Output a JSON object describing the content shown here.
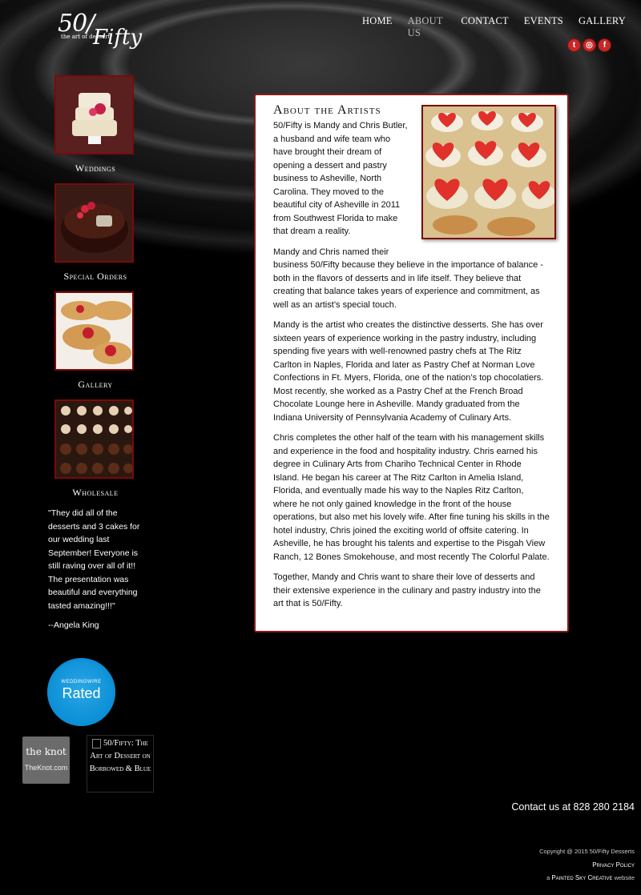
{
  "brand": {
    "logo_text": "50/",
    "logo_fifty": "Fifty",
    "logo_tagline": "the art of dessert"
  },
  "nav": {
    "items": [
      {
        "label": "HOME"
      },
      {
        "label": "ABOUT US"
      },
      {
        "label": "CONTACT"
      },
      {
        "label": "EVENTS"
      },
      {
        "label": "GALLERY"
      }
    ],
    "active": "ABOUT US"
  },
  "social": [
    {
      "icon": "twitter-icon",
      "glyph": "t"
    },
    {
      "icon": "instagram-icon",
      "glyph": "◎"
    },
    {
      "icon": "facebook-icon",
      "glyph": "f"
    }
  ],
  "sidebar": {
    "items": [
      {
        "label": "Weddings"
      },
      {
        "label": "Special Orders"
      },
      {
        "label": "Gallery"
      },
      {
        "label": "Wholesale"
      }
    ],
    "testimonial": {
      "quote": "\"They did all of the desserts and 3 cakes for our wedding last September! Everyone is still raving over all of it!! The presentation was beautiful and everything tasted amazing!!!\"",
      "author": "--Angela King"
    },
    "weddingwire": {
      "top": "WEDDINGWIRE",
      "main": "Rated"
    },
    "theknot": {
      "logo": "the knot",
      "caption": "TheKnot.com"
    },
    "borrowed_blue_alt": "50/Fifty: The Art of Dessert on Borrowed & Blue"
  },
  "main": {
    "title": "About the Artists",
    "paragraphs": [
      "50/Fifty is Mandy and Chris Butler, a husband and wife team who have brought their dream of opening a dessert and pastry business to Asheville, North Carolina. They moved to the beautiful city of Asheville in 2011 from Southwest Florida to make that dream a reality.",
      "Mandy and Chris named their business 50/Fifty because they believe in the importance of balance - both in the flavors of desserts and in life itself.  They believe that creating that balance takes years of experience and commitment, as well as an artist’s special touch.",
      "Mandy is the artist who creates the distinctive desserts. She has over sixteen years of experience working in the pastry industry, including spending five years with well-renowned pastry chefs at The Ritz Carlton in Naples, Florida and later as Pastry Chef at Norman Love Confections in Ft. Myers, Florida, one of the nation’s top chocolatiers. Most recently, she worked as a Pastry Chef at the French Broad Chocolate Lounge here in Asheville.  Mandy graduated from the Indiana University of Pennsylvania Academy of Culinary Arts.",
      "Chris completes the other half of the team with his management skills and experience in the food and hospitality industry. Chris earned his degree in Culinary Arts from Chariho Technical Center in Rhode Island. He began his career at The Ritz Carlton in Amelia Island, Florida, and eventually made his way to the Naples Ritz Carlton, where he not only gained knowledge in the front of the house operations, but also met his lovely wife.  After fine tuning his skills in the hotel industry, Chris joined the exciting world of offsite catering. In Asheville, he has brought his talents and expertise to the Pisgah View Ranch, 12 Bones Smokehouse, and most recently The Colorful Palate.",
      "Together, Mandy and Chris want to share their love of desserts and their extensive experience in the culinary and pastry industry into the art that is 50/Fifty."
    ]
  },
  "footer": {
    "contact": "Contact us at 828 280 2184",
    "copyright": "Copyright @ 2015 50/Fifty Desserts",
    "privacy": "Privacy Policy",
    "credit_prefix": "a",
    "credit_name": "Painted Sky Creative",
    "credit_suffix": "website"
  },
  "colors": {
    "accent": "#8b1a1a",
    "social": "#c62828",
    "weddingwire": "#0b8fd6"
  }
}
